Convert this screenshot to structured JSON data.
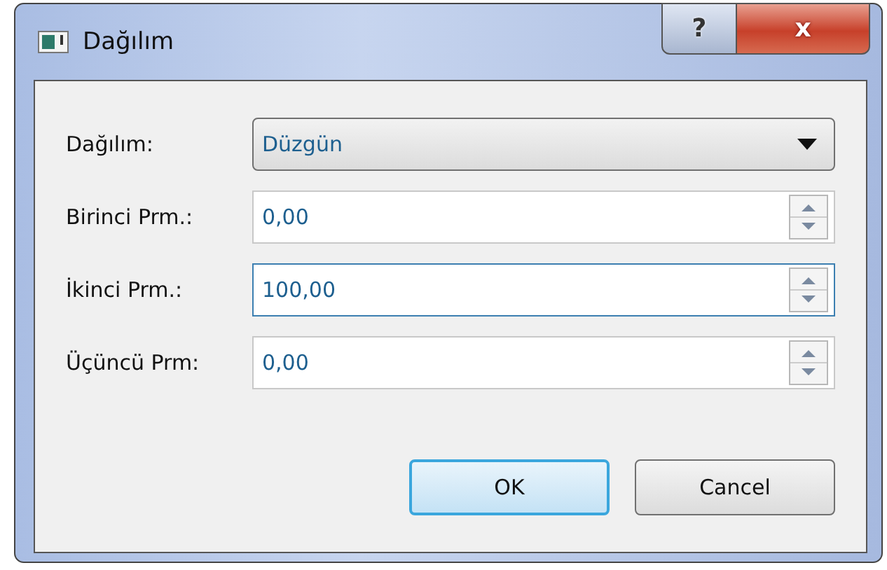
{
  "window": {
    "title": "Dağılım",
    "help_button": "?",
    "close_button": "x"
  },
  "rows": [
    {
      "kind": "combo",
      "label": "Dağılım:",
      "value": "Düzgün",
      "focused": false
    },
    {
      "kind": "spin",
      "label": "Birinci Prm.:",
      "value": "0,00",
      "focused": false
    },
    {
      "kind": "spin",
      "label": "İkinci Prm.:",
      "value": "100,00",
      "focused": true
    },
    {
      "kind": "spin",
      "label": "Üçüncü Prm:",
      "value": "0,00",
      "focused": false
    }
  ],
  "buttons": [
    {
      "label": "OK",
      "default": true
    },
    {
      "label": "Cancel",
      "default": false
    }
  ]
}
